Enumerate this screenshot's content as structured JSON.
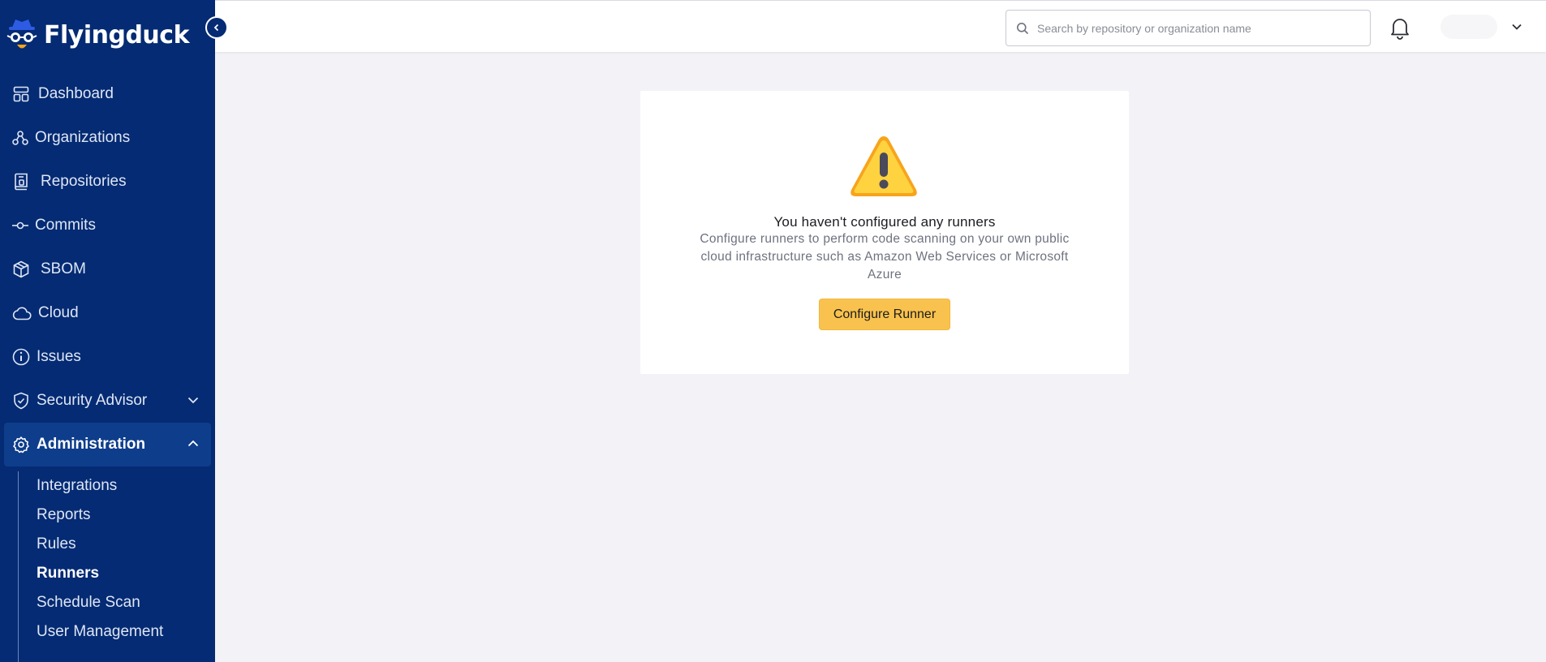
{
  "brand": {
    "name": "Flyingduck"
  },
  "sidebar": {
    "items": [
      {
        "label": "Dashboard",
        "icon": "dashboard-icon"
      },
      {
        "label": "Organizations",
        "icon": "organizations-icon"
      },
      {
        "label": "Repositories",
        "icon": "repositories-icon"
      },
      {
        "label": "Commits",
        "icon": "commits-icon"
      },
      {
        "label": "SBOM",
        "icon": "sbom-icon"
      },
      {
        "label": "Cloud",
        "icon": "cloud-icon"
      },
      {
        "label": "Issues",
        "icon": "info-icon"
      },
      {
        "label": "Security Advisor",
        "icon": "shield-icon"
      },
      {
        "label": "Administration",
        "icon": "gear-icon"
      }
    ],
    "admin_subitems": [
      {
        "label": "Integrations"
      },
      {
        "label": "Reports"
      },
      {
        "label": "Rules"
      },
      {
        "label": "Runners"
      },
      {
        "label": "Schedule Scan"
      },
      {
        "label": "User Management"
      }
    ],
    "active_item": "Administration",
    "current_subitem": "Runners"
  },
  "topbar": {
    "search": {
      "placeholder": "Search by repository or organization name",
      "value": ""
    }
  },
  "main": {
    "empty_state": {
      "icon": "warning-icon",
      "title": "You haven't configured any runners",
      "description": "Configure runners to perform code scanning on your own public cloud infrastructure such as Amazon Web Services or Microsoft Azure",
      "button_label": "Configure Runner"
    }
  },
  "colors": {
    "sidebar_bg": "#042b73",
    "active_bg": "#0e3d8b",
    "accent": "#f9c24e",
    "page_bg": "#f3f3f7"
  }
}
